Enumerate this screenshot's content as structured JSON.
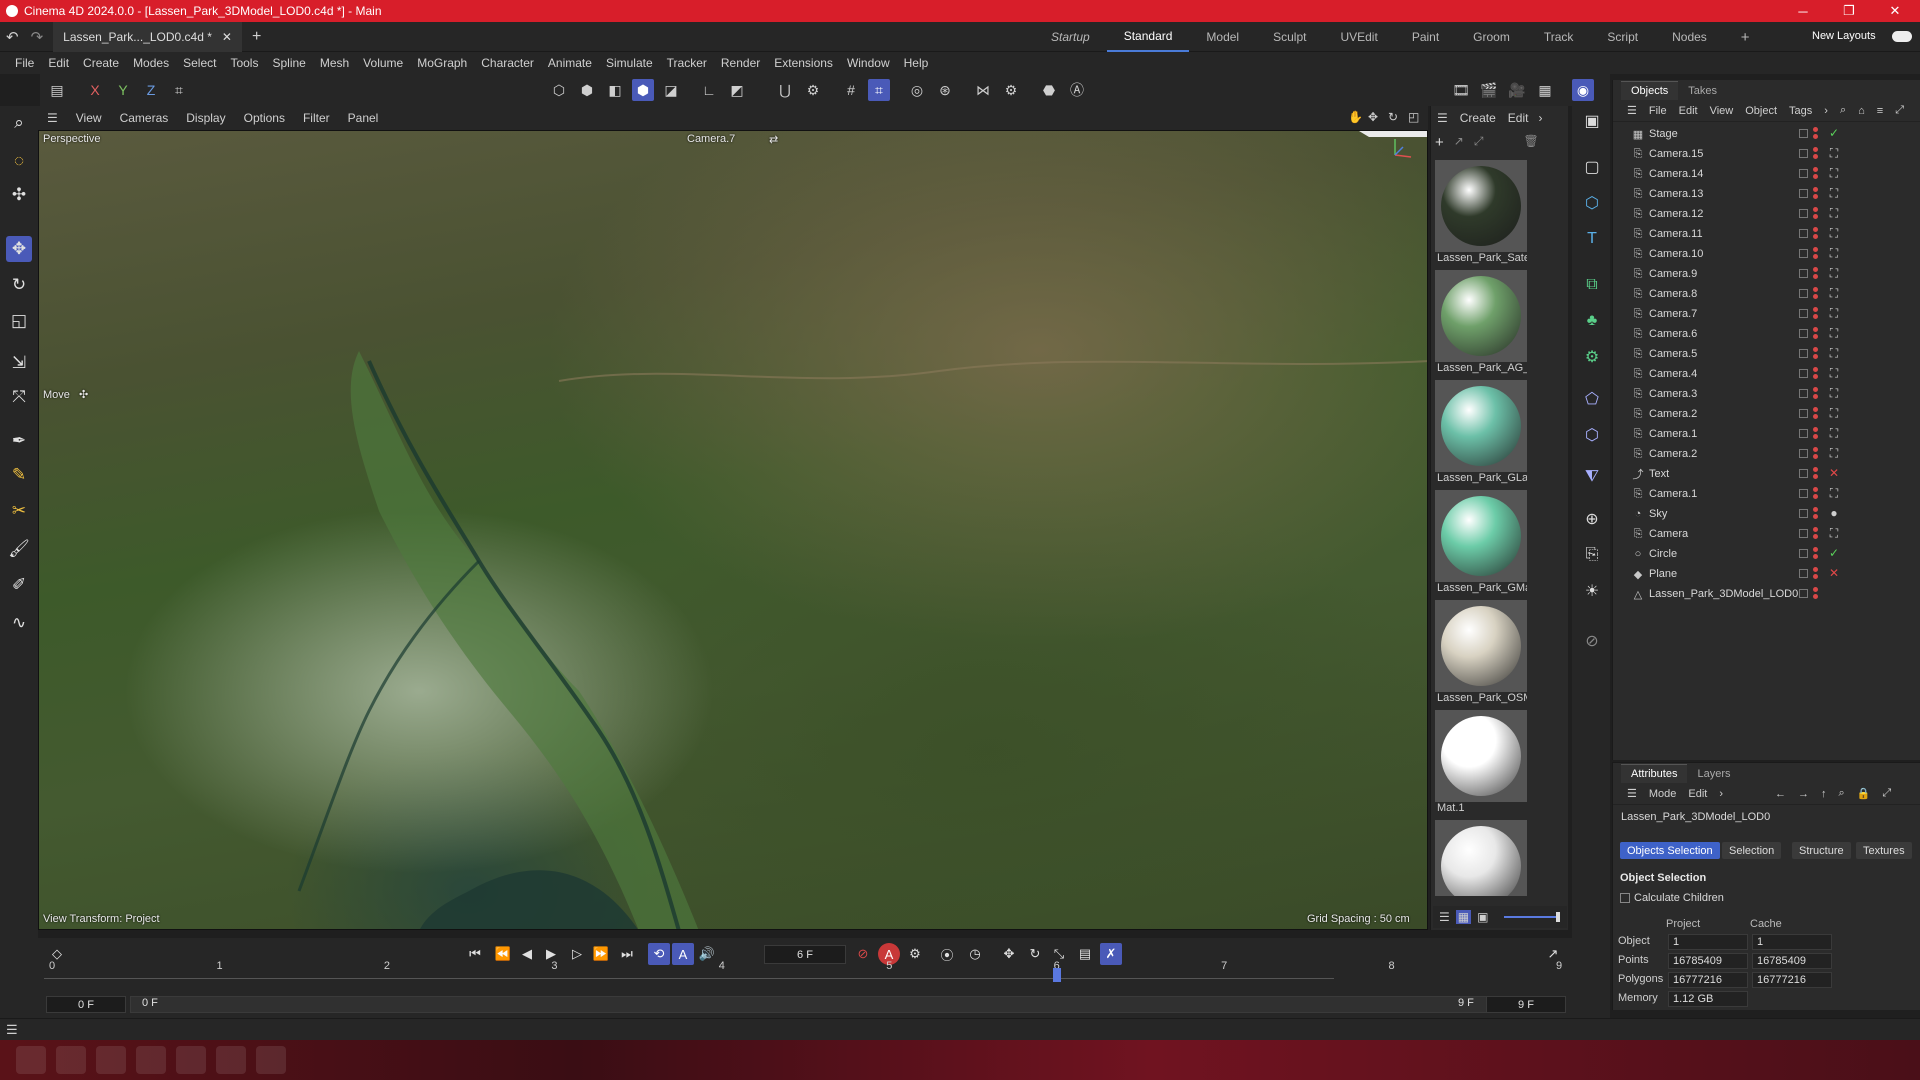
{
  "window": {
    "title": "Cinema 4D 2024.0.0 - [Lassen_Park_3DModel_LOD0.c4d *] - Main",
    "document_tab": "Lassen_Park..._LOD0.c4d *"
  },
  "layouts": {
    "tabs": [
      "Startup",
      "Standard",
      "Model",
      "Sculpt",
      "UVEdit",
      "Paint",
      "Groom",
      "Track",
      "Script",
      "Nodes"
    ],
    "active": "Standard",
    "new_layouts": "New Layouts"
  },
  "menu": [
    "File",
    "Edit",
    "Create",
    "Modes",
    "Select",
    "Tools",
    "Spline",
    "Mesh",
    "Volume",
    "MoGraph",
    "Character",
    "Animate",
    "Simulate",
    "Tracker",
    "Render",
    "Extensions",
    "Window",
    "Help"
  ],
  "toolbar": {
    "axis_x": "X",
    "axis_y": "Y",
    "axis_z": "Z"
  },
  "viewport": {
    "menu": [
      "View",
      "Cameras",
      "Display",
      "Options",
      "Filter",
      "Panel"
    ],
    "projection": "Perspective",
    "camera": "Camera.7",
    "tool_hint": "Move",
    "view_transform": "View Transform: Project",
    "grid_spacing": "Grid Spacing : 50 cm"
  },
  "materials": {
    "menu": [
      "Create",
      "Edit"
    ],
    "items": [
      {
        "name": "Lassen_Park_Satel",
        "color": "#2f3a2a"
      },
      {
        "name": "Lassen_Park_AG_L",
        "color": "#6fa06a"
      },
      {
        "name": "Lassen_Park_GLan",
        "color": "#6cc0a8"
      },
      {
        "name": "Lassen_Park_GMa",
        "color": "#6ccca8"
      },
      {
        "name": "Lassen_Park_OSM",
        "color": "#d8d2c2"
      },
      {
        "name": "Mat.1",
        "color": "#ffffff"
      },
      {
        "name": "",
        "color": "#e8e8e8"
      }
    ]
  },
  "objects_panel": {
    "tabs": [
      "Objects",
      "Takes"
    ],
    "menu": [
      "File",
      "Edit",
      "View",
      "Object",
      "Tags"
    ],
    "items": [
      {
        "name": "Stage",
        "icon": "stage-icon",
        "tag": "✓"
      },
      {
        "name": "Camera.15",
        "icon": "camera-icon",
        "tag": "⛶"
      },
      {
        "name": "Camera.14",
        "icon": "camera-icon",
        "tag": "⛶"
      },
      {
        "name": "Camera.13",
        "icon": "camera-icon",
        "tag": "⛶"
      },
      {
        "name": "Camera.12",
        "icon": "camera-icon",
        "tag": "⛶"
      },
      {
        "name": "Camera.11",
        "icon": "camera-icon",
        "tag": "⛶"
      },
      {
        "name": "Camera.10",
        "icon": "camera-icon",
        "tag": "⛶"
      },
      {
        "name": "Camera.9",
        "icon": "camera-icon",
        "tag": "⛶"
      },
      {
        "name": "Camera.8",
        "icon": "camera-icon",
        "tag": "⛶"
      },
      {
        "name": "Camera.7",
        "icon": "camera-icon",
        "tag": "⛶"
      },
      {
        "name": "Camera.6",
        "icon": "camera-icon",
        "tag": "⛶"
      },
      {
        "name": "Camera.5",
        "icon": "camera-icon",
        "tag": "⛶"
      },
      {
        "name": "Camera.4",
        "icon": "camera-icon",
        "tag": "⛶"
      },
      {
        "name": "Camera.3",
        "icon": "camera-icon",
        "tag": "⛶"
      },
      {
        "name": "Camera.2",
        "icon": "camera-icon",
        "tag": "⛶"
      },
      {
        "name": "Camera.1",
        "icon": "camera-icon",
        "tag": "⛶"
      },
      {
        "name": "Camera.2",
        "icon": "camera-icon",
        "tag": "⛶"
      },
      {
        "name": "Text",
        "icon": "text-icon",
        "tag": "✕"
      },
      {
        "name": "Camera.1",
        "icon": "camera-icon",
        "tag": "⛶"
      },
      {
        "name": "Sky",
        "icon": "sky-icon",
        "tag": "●"
      },
      {
        "name": "Camera",
        "icon": "camera-icon",
        "tag": "⛶"
      },
      {
        "name": "Circle",
        "icon": "circle-icon",
        "tag": "✓"
      },
      {
        "name": "Plane",
        "icon": "plane-icon",
        "tag": "✕"
      },
      {
        "name": "Lassen_Park_3DModel_LOD0",
        "icon": "polygon-icon",
        "tag": ""
      }
    ]
  },
  "attributes": {
    "tabs": [
      "Attributes",
      "Layers"
    ],
    "menu": [
      "Mode",
      "Edit"
    ],
    "object_name": "Lassen_Park_3DModel_LOD0",
    "buttons": [
      "Objects Selection",
      "Selection",
      "Structure",
      "Textures"
    ],
    "active_button": "Objects Selection",
    "section": "Object Selection",
    "calc_children": "Calculate Children",
    "col_project": "Project",
    "col_cache": "Cache",
    "rows": [
      {
        "label": "Object",
        "project": "1",
        "cache": "1"
      },
      {
        "label": "Points",
        "project": "16785409",
        "cache": "16785409"
      },
      {
        "label": "Polygons",
        "project": "16777216",
        "cache": "16777216"
      },
      {
        "label": "Memory",
        "project": "1.12 GB",
        "cache": ""
      }
    ]
  },
  "timeline": {
    "current_frame": "6 F",
    "start": "0 F",
    "start2": "0 F",
    "end": "9 F",
    "end2": "9 F",
    "ticks": [
      "0",
      "1",
      "2",
      "3",
      "4",
      "5",
      "6",
      "7",
      "8",
      "9"
    ],
    "playhead_frame": 6
  },
  "colors": {
    "title_bar": "#d81e2a",
    "accent": "#4a5ab8"
  }
}
